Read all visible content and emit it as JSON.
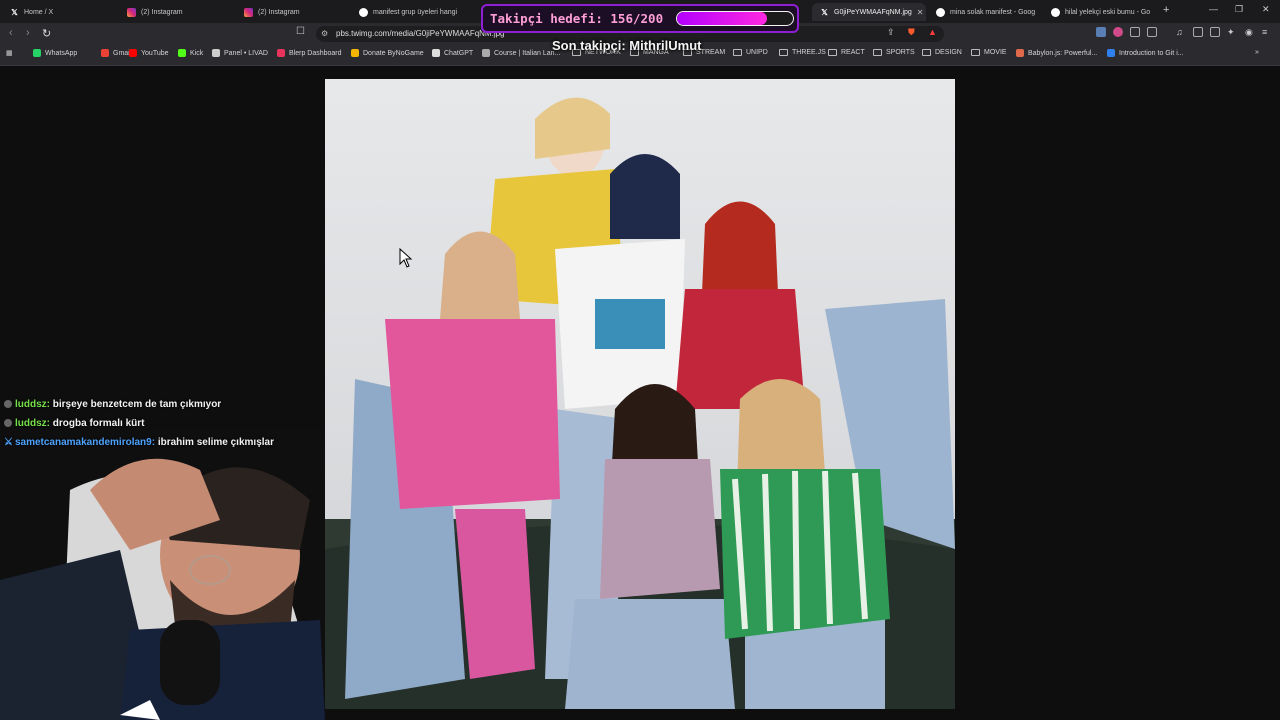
{
  "browser": {
    "tabs": [
      {
        "title": "Home / X",
        "icon": "x-icon"
      },
      {
        "title": "(2) Instagram",
        "icon": "instagram-icon"
      },
      {
        "title": "(2) Instagram",
        "icon": "instagram-icon"
      },
      {
        "title": "manifest grup üyeleri hangi",
        "icon": "google-icon"
      },
      {
        "title": "G0jiPeYWMAAFqNM.jpg",
        "icon": "x-icon",
        "active": true
      },
      {
        "title": "mina solak manifest - Goog",
        "icon": "google-icon"
      },
      {
        "title": "hilal yelekçi eski bumu - Go",
        "icon": "google-icon"
      }
    ],
    "new_tab_symbol": "+",
    "window_controls": {
      "minimize": "—",
      "maximize": "❐",
      "close": "✕"
    },
    "url": "pbs.twimg.com/media/G0jiPeYWMAAFqNM.jpg",
    "bookmarks": [
      {
        "label": "WhatsApp",
        "kind": "site",
        "color": "#25d366"
      },
      {
        "label": "Gmail",
        "kind": "site",
        "color": "#ea4335"
      },
      {
        "label": "YouTube",
        "kind": "site",
        "color": "#ff0000"
      },
      {
        "label": "Kick",
        "kind": "site",
        "color": "#53fc18"
      },
      {
        "label": "Panel • LIVAD",
        "kind": "site",
        "color": "#cccccc"
      },
      {
        "label": "Blerp Dashboard",
        "kind": "site",
        "color": "#e8345d"
      },
      {
        "label": "Donate ByNoGame",
        "kind": "site",
        "color": "#f5b400"
      },
      {
        "label": "ChatGPT",
        "kind": "site",
        "color": "#dddddd"
      },
      {
        "label": "Course | Italian Lan...",
        "kind": "site",
        "color": "#aaaaaa"
      },
      {
        "label": "NETWORK",
        "kind": "folder"
      },
      {
        "label": "MANGA",
        "kind": "folder"
      },
      {
        "label": "STREAM",
        "kind": "folder"
      },
      {
        "label": "UNIPD",
        "kind": "folder"
      },
      {
        "label": "THREE.JS",
        "kind": "folder"
      },
      {
        "label": "REACT",
        "kind": "folder"
      },
      {
        "label": "SPORTS",
        "kind": "folder"
      },
      {
        "label": "DESIGN",
        "kind": "folder"
      },
      {
        "label": "MOVIE",
        "kind": "folder"
      },
      {
        "label": "Babylon.js: Powerful...",
        "kind": "site",
        "color": "#e0684b"
      },
      {
        "label": "Introduction to Git i...",
        "kind": "site",
        "color": "#2f80ed"
      }
    ]
  },
  "overlay": {
    "goal_text": "Takipçi hedefi: 156/200",
    "goal_current": 156,
    "goal_target": 200,
    "last_follower": "Son takipçi: MithrilUmut"
  },
  "chat": [
    {
      "user": "luddsz",
      "text": "birşeye benzetcem de tam çıkmıyor",
      "color": "green"
    },
    {
      "user": "luddsz",
      "text": "drogba formalı kürt",
      "color": "green"
    },
    {
      "user": "sametcanamakandemirolan9",
      "text": "ibrahim selime çıkmışlar",
      "color": "blue"
    }
  ],
  "colors": {
    "goal_border": "#8f1fd2",
    "goal_text": "#ff9fd7",
    "chat_green": "#76e04a",
    "chat_blue": "#4da3ff"
  }
}
